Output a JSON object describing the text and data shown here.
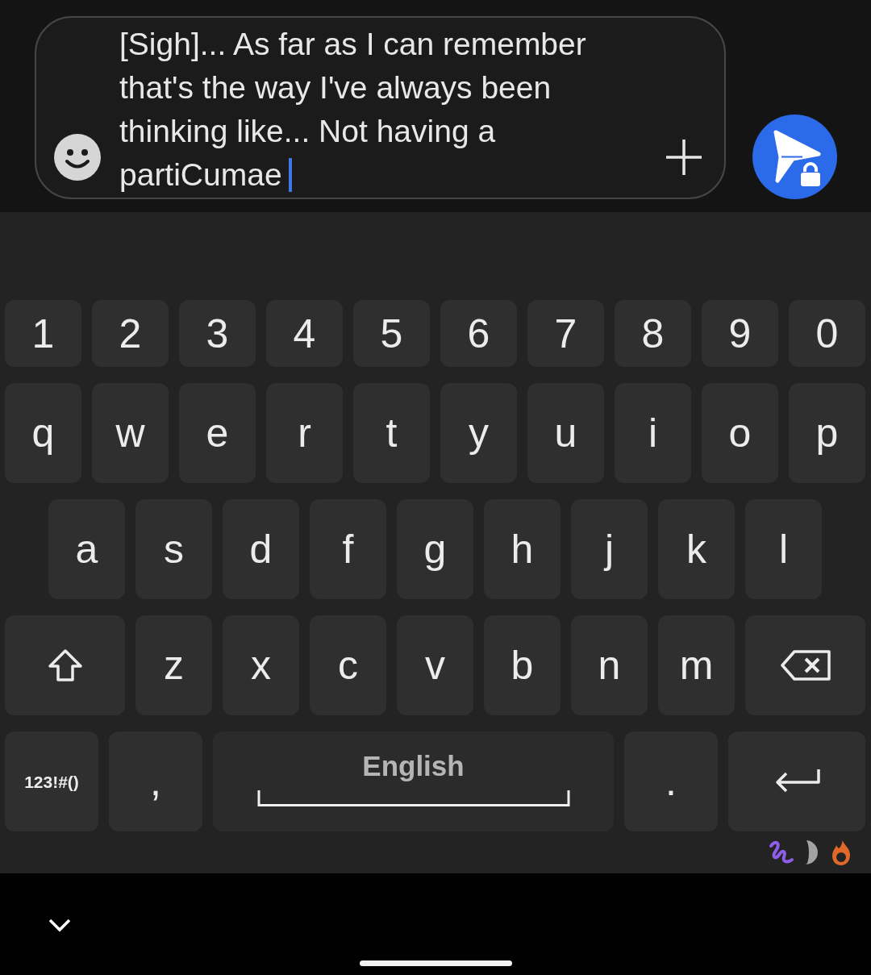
{
  "message_input": {
    "value": "[Sigh]... As far as I can remember that's the way I've always been thinking like... Not having a partiCumae"
  },
  "keyboard": {
    "rows": [
      {
        "keys": [
          {
            "kind": "key",
            "label": "1"
          },
          {
            "kind": "key",
            "label": "2"
          },
          {
            "kind": "key",
            "label": "3"
          },
          {
            "kind": "key",
            "label": "4"
          },
          {
            "kind": "key",
            "label": "5"
          },
          {
            "kind": "key",
            "label": "6"
          },
          {
            "kind": "key",
            "label": "7"
          },
          {
            "kind": "key",
            "label": "8"
          },
          {
            "kind": "key",
            "label": "9"
          },
          {
            "kind": "key",
            "label": "0"
          }
        ]
      },
      {
        "keys": [
          {
            "kind": "key",
            "label": "q"
          },
          {
            "kind": "key",
            "label": "w"
          },
          {
            "kind": "key",
            "label": "e"
          },
          {
            "kind": "key",
            "label": "r"
          },
          {
            "kind": "key",
            "label": "t"
          },
          {
            "kind": "key",
            "label": "y"
          },
          {
            "kind": "key",
            "label": "u"
          },
          {
            "kind": "key",
            "label": "i"
          },
          {
            "kind": "key",
            "label": "o"
          },
          {
            "kind": "key",
            "label": "p"
          }
        ]
      },
      {
        "keys": [
          {
            "kind": "key",
            "label": "a"
          },
          {
            "kind": "key",
            "label": "s"
          },
          {
            "kind": "key",
            "label": "d"
          },
          {
            "kind": "key",
            "label": "f"
          },
          {
            "kind": "key",
            "label": "g"
          },
          {
            "kind": "key",
            "label": "h"
          },
          {
            "kind": "key",
            "label": "j"
          },
          {
            "kind": "key",
            "label": "k"
          },
          {
            "kind": "key",
            "label": "l"
          }
        ]
      },
      {
        "keys": [
          {
            "kind": "shift"
          },
          {
            "kind": "key",
            "label": "z"
          },
          {
            "kind": "key",
            "label": "x"
          },
          {
            "kind": "key",
            "label": "c"
          },
          {
            "kind": "key",
            "label": "v"
          },
          {
            "kind": "key",
            "label": "b"
          },
          {
            "kind": "key",
            "label": "n"
          },
          {
            "kind": "key",
            "label": "m"
          },
          {
            "kind": "backspace"
          }
        ]
      },
      {
        "keys": [
          {
            "kind": "symbols",
            "label": "123!#()"
          },
          {
            "kind": "key",
            "label": ","
          },
          {
            "kind": "space",
            "label": "English"
          },
          {
            "kind": "key",
            "label": "."
          },
          {
            "kind": "enter"
          }
        ]
      }
    ]
  }
}
